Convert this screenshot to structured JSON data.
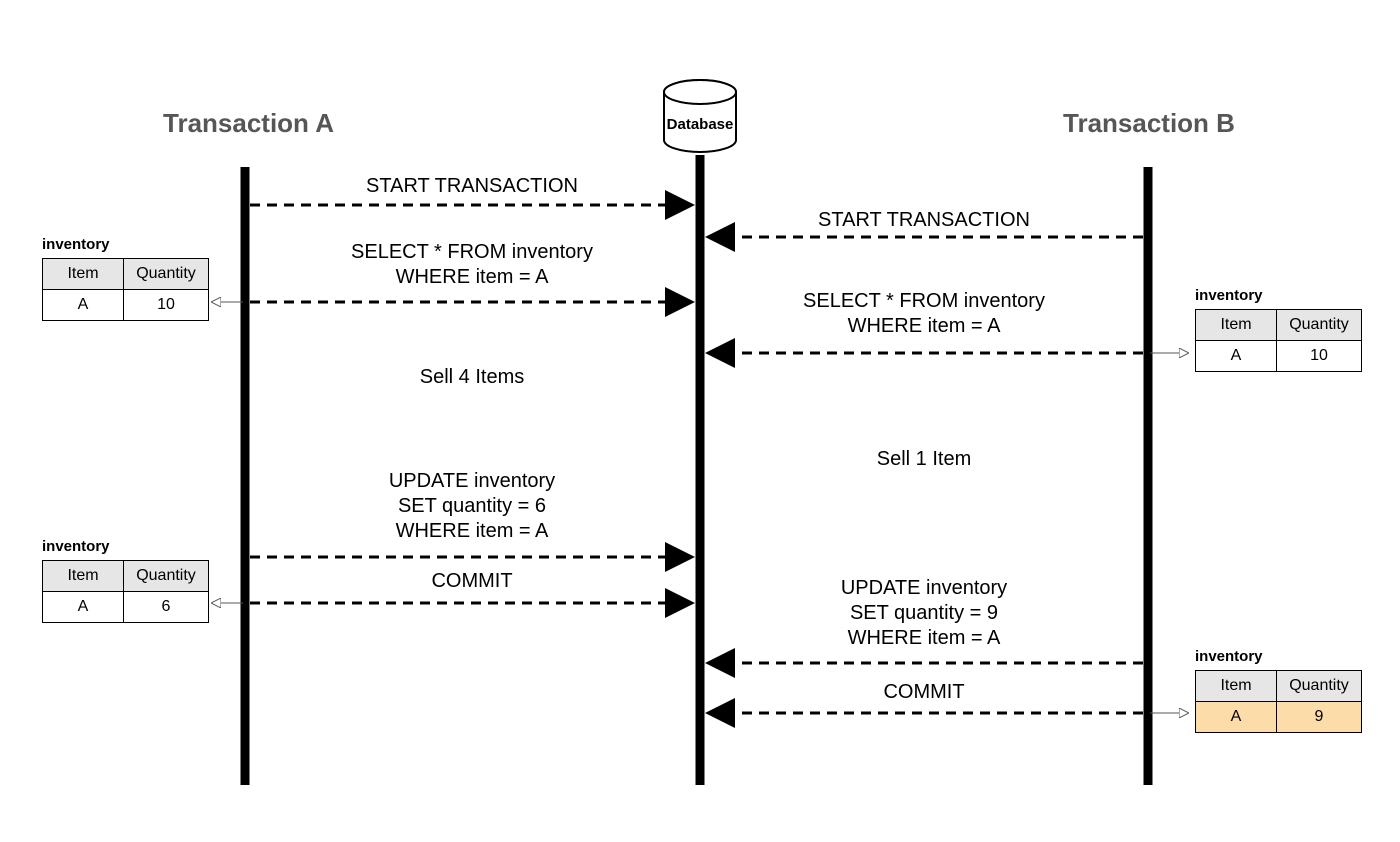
{
  "headings": {
    "tx_a": "Transaction A",
    "tx_b": "Transaction B",
    "db": "Database"
  },
  "messages": {
    "a_start": "START TRANSACTION",
    "a_select": "SELECT * FROM inventory\nWHERE item = A",
    "a_sell": "Sell 4 Items",
    "a_update": "UPDATE inventory\nSET quantity = 6\nWHERE item = A",
    "a_commit": "COMMIT",
    "b_start": "START TRANSACTION",
    "b_select": "SELECT * FROM inventory\nWHERE item = A",
    "b_sell": "Sell 1 Item",
    "b_update": "UPDATE inventory\nSET quantity = 9\nWHERE item = A",
    "b_commit": "COMMIT"
  },
  "table_labels": {
    "title": "inventory",
    "item_col": "Item",
    "qty_col": "Quantity",
    "item_val": "A"
  },
  "snapshots": {
    "a1_qty": "10",
    "a2_qty": "6",
    "b1_qty": "10",
    "b2_qty": "9"
  }
}
